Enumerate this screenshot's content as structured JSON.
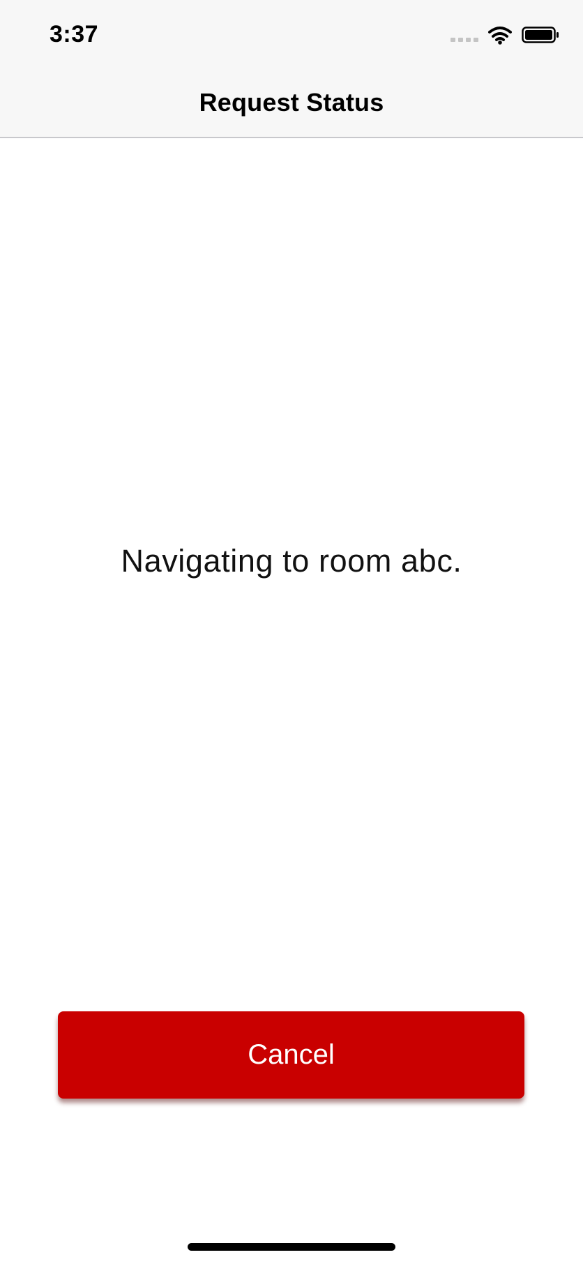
{
  "status_bar": {
    "time": "3:37",
    "icons": [
      "signal-icon",
      "wifi-icon",
      "battery-icon"
    ]
  },
  "nav": {
    "title": "Request Status"
  },
  "content": {
    "message": "Navigating to room abc."
  },
  "actions": {
    "cancel_label": "Cancel"
  },
  "colors": {
    "accent": "#c90000",
    "nav_background": "#f7f7f7",
    "text": "#000000"
  }
}
